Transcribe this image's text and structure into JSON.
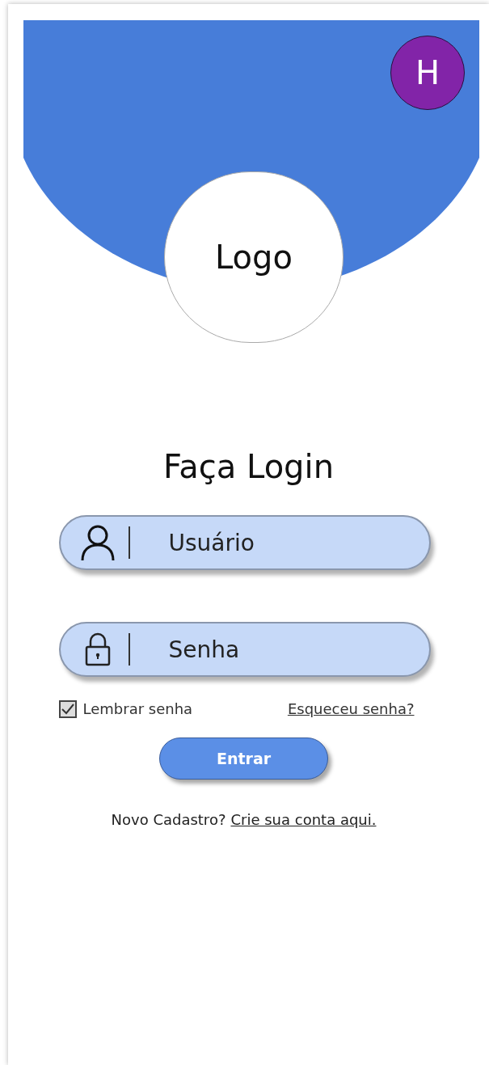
{
  "avatar": {
    "initial": "H"
  },
  "logo": {
    "text": "Logo"
  },
  "title": "Faça Login",
  "fields": [
    {
      "kind": "user",
      "placeholder": "Usuário"
    },
    {
      "kind": "password",
      "placeholder": "Senha"
    }
  ],
  "remember": {
    "label": "Lembrar senha",
    "checked": true
  },
  "forgot_link": "Esqueceu senha?",
  "submit_button": "Entrar",
  "signup": {
    "prompt": "Novo Cadastro?",
    "link": "Crie sua conta aqui."
  }
}
